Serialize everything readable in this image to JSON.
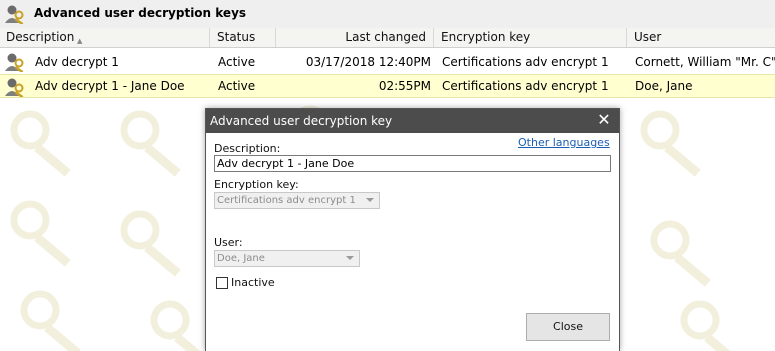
{
  "window": {
    "title": "Advanced user decryption keys",
    "title_icon": "user-key-icon"
  },
  "columns": [
    {
      "label": "Description"
    },
    {
      "label": "Status"
    },
    {
      "label": "Last changed"
    },
    {
      "label": "Encryption key"
    },
    {
      "label": "User"
    }
  ],
  "sort_indicator": "▲",
  "rows": [
    {
      "description": "Adv decrypt 1",
      "status": "Active",
      "last_changed": "03/17/2018 12:40PM",
      "encryption_key": "Certifications adv encrypt 1",
      "user": "Cornett, William \"Mr. C\""
    },
    {
      "description": "Adv decrypt 1 - Jane Doe",
      "status": "Active",
      "last_changed": "02:55PM",
      "encryption_key": "Certifications adv encrypt 1",
      "user": "Doe, Jane"
    }
  ],
  "dialog": {
    "title": "Advanced user decryption key",
    "close_glyph": "✕",
    "description_label": "Description:",
    "other_languages_link": "Other languages",
    "description_value": "Adv decrypt 1 - Jane Doe",
    "encryption_key_label": "Encryption key:",
    "encryption_key_value": "Certifications adv encrypt 1",
    "user_label": "User:",
    "user_value": "Doe, Jane",
    "inactive_label": "Inactive",
    "inactive_checked": false,
    "close_button": "Close"
  },
  "colors": {
    "selected_row": "#ffffd0",
    "dialog_title": "#4c4c4c",
    "link": "#1a5fb4"
  }
}
